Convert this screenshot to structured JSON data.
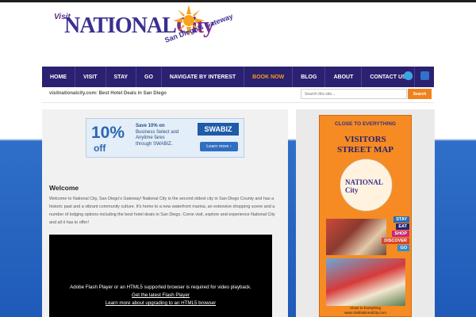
{
  "header": {
    "logo_visit": "Visit",
    "logo_national": "NATIONAL",
    "logo_city": "City",
    "logo_tagline": "San Diego's Gateway"
  },
  "nav": {
    "items": [
      {
        "label": "Home"
      },
      {
        "label": "Visit"
      },
      {
        "label": "Stay"
      },
      {
        "label": "Go"
      },
      {
        "label": "Navigate by Interest"
      },
      {
        "label": "Book Now"
      },
      {
        "label": "Blog"
      },
      {
        "label": "About"
      },
      {
        "label": "Contact Us"
      }
    ],
    "social": [
      "twitter-icon",
      "rss-icon"
    ]
  },
  "subheader": {
    "tagline": "visitnationalcity.com: Best Hotel Deals in San Diego",
    "search_placeholder": "Search this site...",
    "search_button": "Search"
  },
  "ad": {
    "percent": "10%",
    "off": "off",
    "line1": "Save 10% on",
    "line2": "Business Select and",
    "line3": "Anytime fares",
    "line4": "through SWABIZ.",
    "brand": "SWABIZ",
    "learn_more": "Learn more ›"
  },
  "welcome": {
    "title": "Welcome",
    "text": "Welcome to National City, San Diego's Gateway! National City is the second oldest city in San Diego County and has a historic past and a vibrant community culture. It's home to a new waterfront marina, an extensive shopping scene and a number of lodging options including the best hotel deals in San Diego. Come visit, explore and experience National City and all it has to offer!"
  },
  "video": {
    "message": "Adobe Flash Player or an HTML5 supported browser is required for video playback.",
    "link1": "Get the latest Flash Player",
    "link2": "Learn more about upgrading to an HTML5 browser"
  },
  "poster": {
    "close": "CLOSE TO EVERYTHING",
    "title1": "VISITORS",
    "title2": "STREET MAP",
    "mini_logo": "NATIONAL City",
    "tags": [
      "STAY",
      "EAT",
      "SHOP",
      "DISCOVER",
      "GO"
    ],
    "footer1": "Close to Everything",
    "footer2": "www.VisitNationalCity.com"
  },
  "colors": {
    "nav_bg": "#2a2170",
    "book_now": "#f79a1e",
    "search_button": "#f0821e",
    "poster_bg": "#f58b22"
  }
}
